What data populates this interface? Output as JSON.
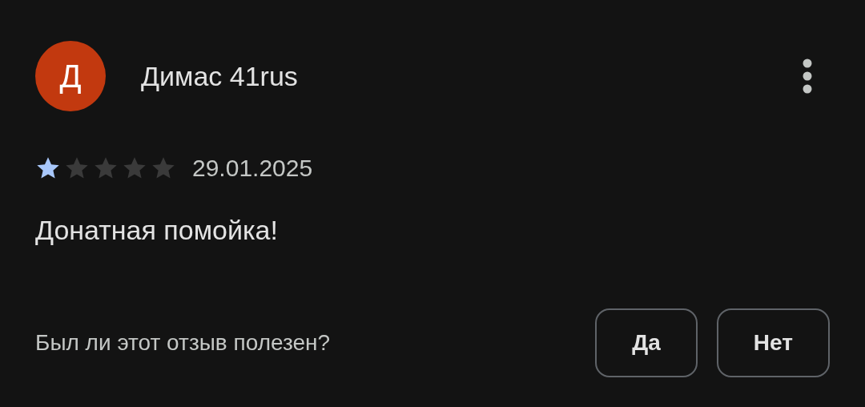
{
  "review": {
    "avatar_letter": "Д",
    "author": "Димас 41rus",
    "stars": 1,
    "date": "29.01.2025",
    "text": "Донатная помойка!"
  },
  "helpful": {
    "question": "Был ли этот отзыв полезен?",
    "buttons": [
      "Да",
      "Нет"
    ]
  }
}
